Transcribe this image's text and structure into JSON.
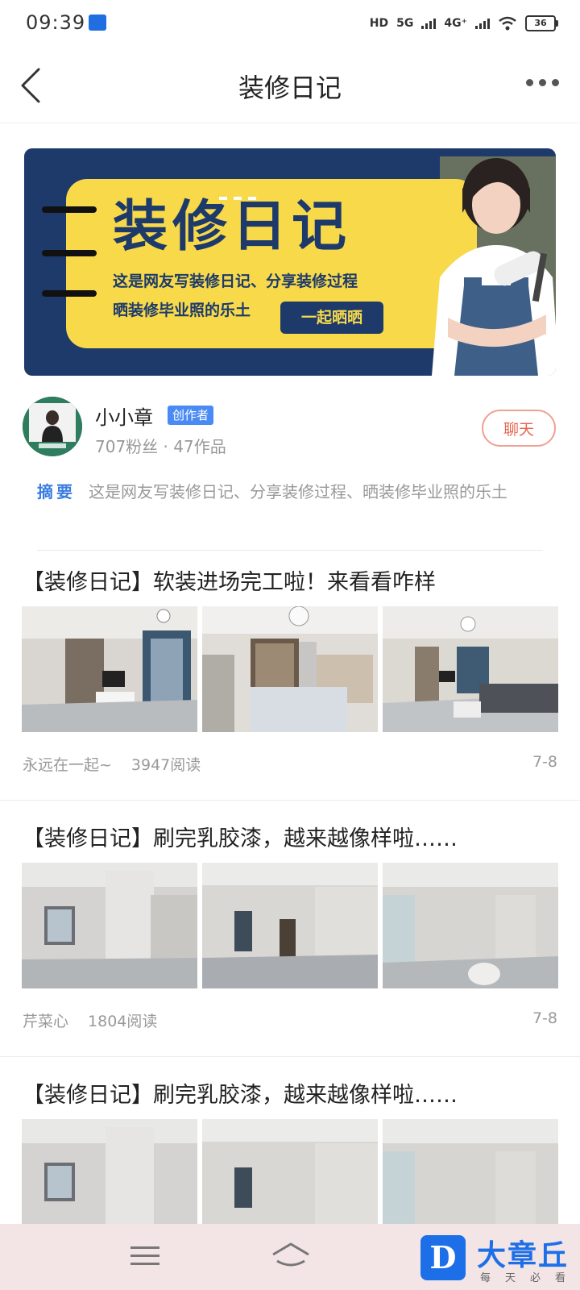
{
  "status_bar": {
    "time": "09:39",
    "network_labels": [
      "HD",
      "5G",
      "4G⁺"
    ],
    "battery": "36"
  },
  "header": {
    "title": "装修日记",
    "icons": [
      "back-icon",
      "more-icon"
    ]
  },
  "banner": {
    "title": "装修日记",
    "line1": "这是网友写装修日记、分享装修过程",
    "line2": "晒装修毕业照的乐土",
    "button_label": "一起晒晒"
  },
  "author": {
    "name": "小小章",
    "badge": "创作者",
    "stats": "707粉丝 · 47作品",
    "chat_label": "聊天"
  },
  "summary": {
    "label": "摘要",
    "text": "这是网友写装修日记、分享装修过程、晒装修毕业照的乐土"
  },
  "posts": [
    {
      "title": "【装修日记】软装进场完工啦！来看看咋样",
      "author": "永远在一起~",
      "reads": "3947阅读",
      "date": "7-8"
    },
    {
      "title": "【装修日记】刷完乳胶漆，越来越像样啦……",
      "author": "芹菜心",
      "reads": "1804阅读",
      "date": "7-8"
    },
    {
      "title": "【装修日记】刷完乳胶漆，越来越像样啦……"
    }
  ],
  "bottom_nav": {
    "logo_mark": "D",
    "logo_text": "大章丘",
    "logo_sub": "每天必看"
  },
  "colors": {
    "accent_blue": "#3a7de0",
    "banner_navy": "#1d3a6b",
    "banner_yellow": "#f7d94a",
    "chat_red": "#e8634c",
    "nav_bg": "#f3e4e6"
  }
}
